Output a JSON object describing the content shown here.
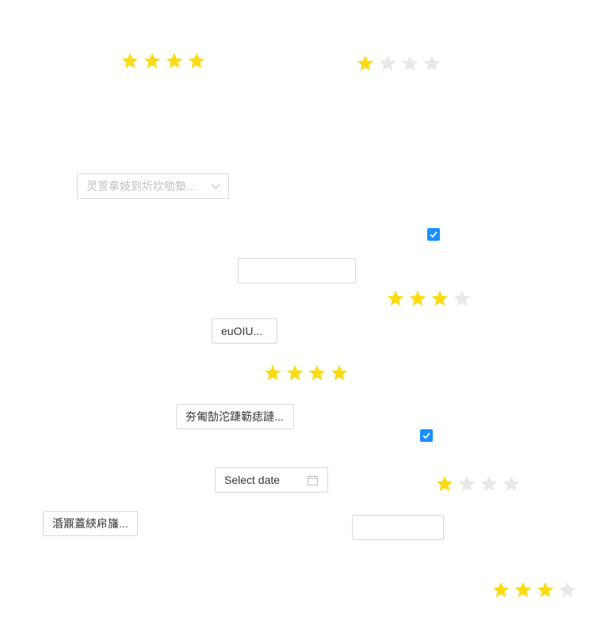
{
  "colors": {
    "star_filled": "#FADB14",
    "star_empty": "#E8E8E8",
    "checkbox": "#1890FF",
    "border": "#D9D9D9"
  },
  "ratings": [
    {
      "value": 4,
      "max": 4
    },
    {
      "value": 1,
      "max": 4
    },
    {
      "value": 3,
      "max": 4
    },
    {
      "value": 4,
      "max": 4
    },
    {
      "value": 1,
      "max": 4
    },
    {
      "value": 3,
      "max": 4
    }
  ],
  "select_1": {
    "placeholder": "灵詈拿妓到圻坎劬塾..."
  },
  "checkbox_1": {
    "checked": true
  },
  "checkbox_2": {
    "checked": true
  },
  "input_1": {
    "value": ""
  },
  "input_2": {
    "value": ""
  },
  "button_1": {
    "label": "euOIU..."
  },
  "button_2": {
    "label": "夯匍勂沱踕簕痣謰..."
  },
  "button_3": {
    "label": "涽鼏蓋綊帍旛..."
  },
  "date_picker": {
    "placeholder": "Select date"
  }
}
